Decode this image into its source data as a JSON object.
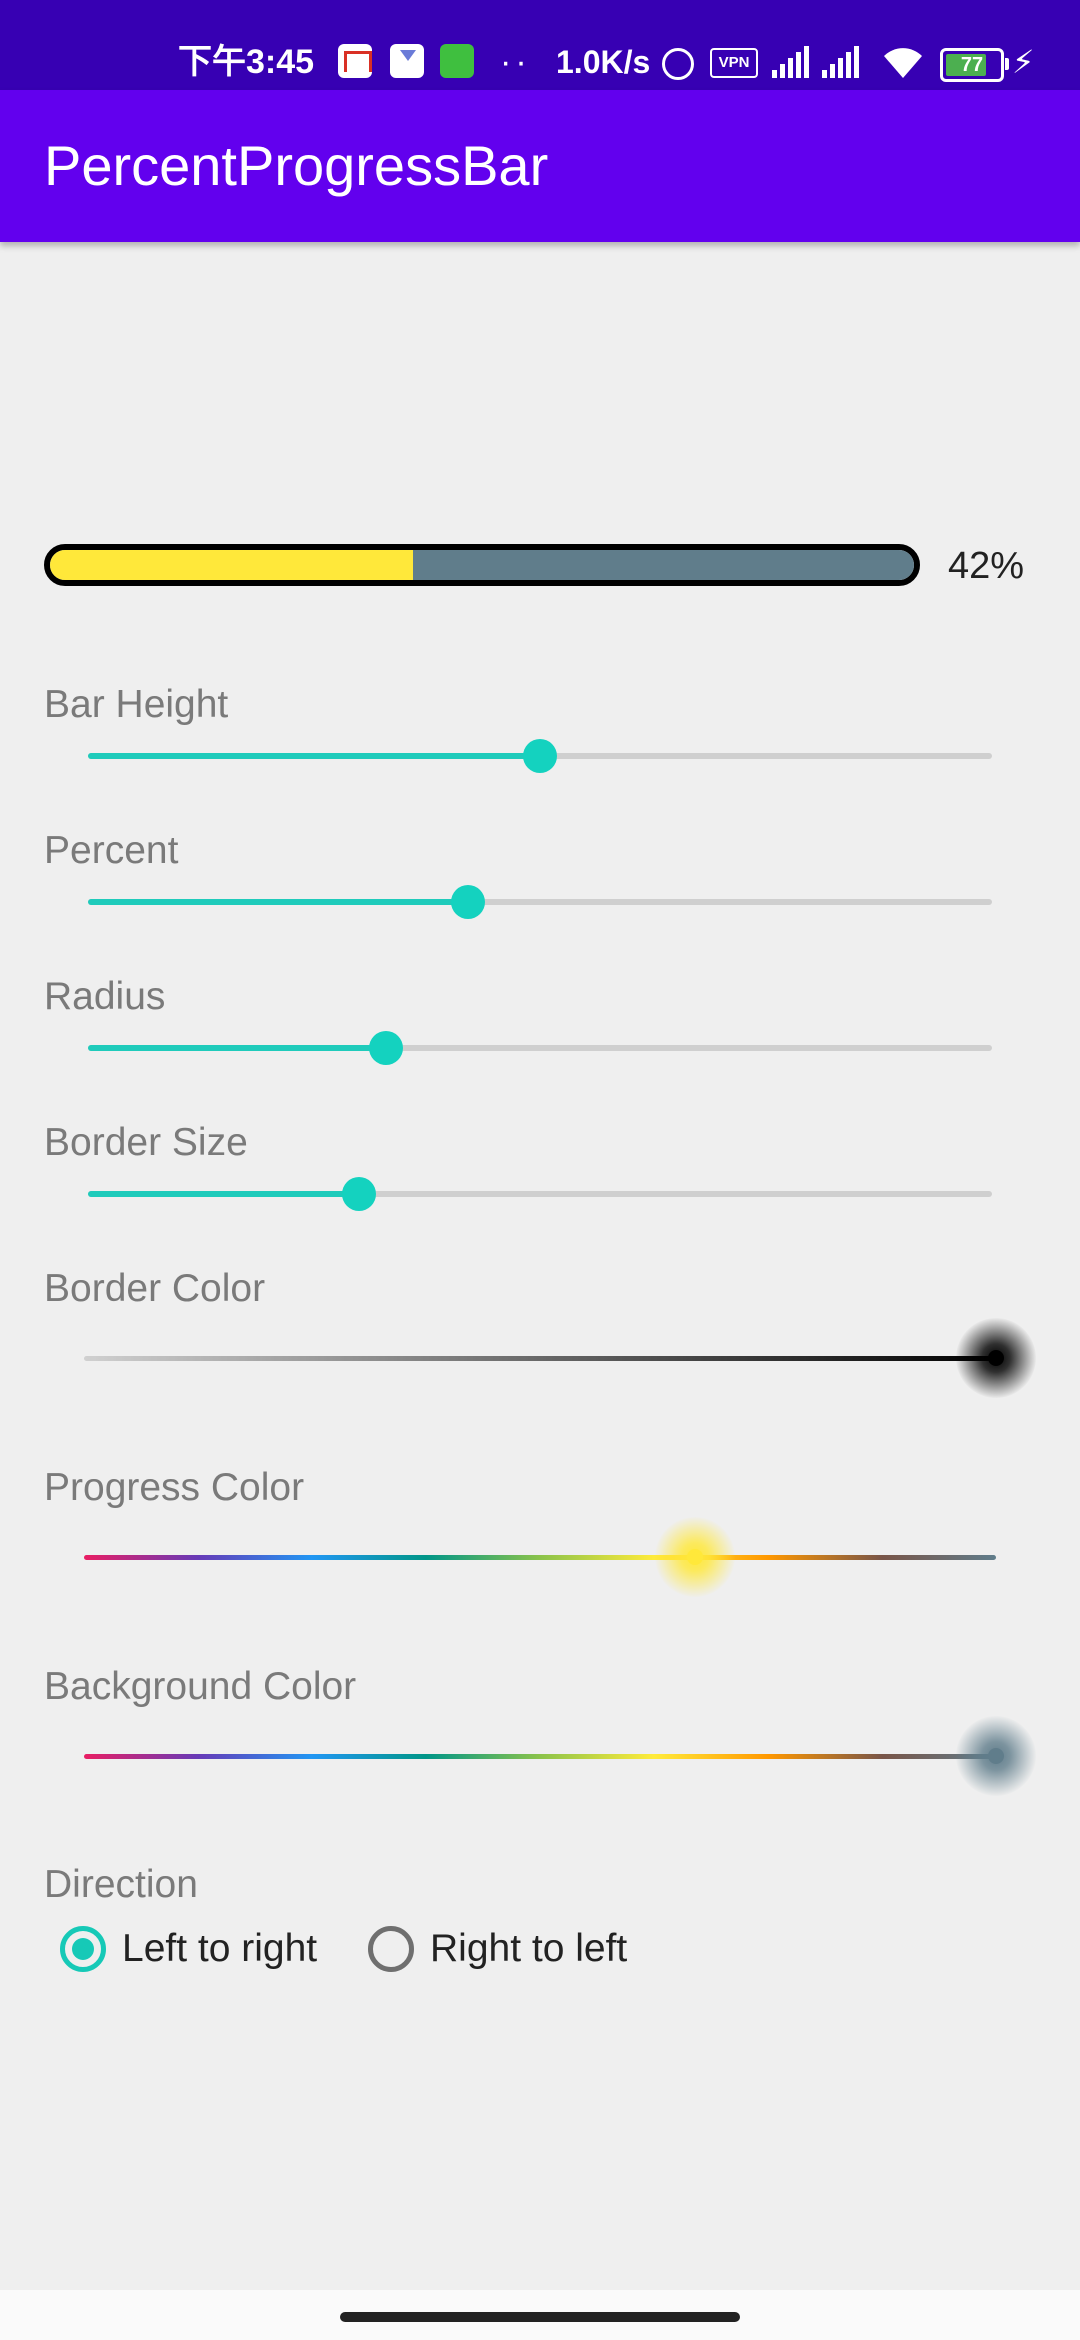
{
  "status_bar": {
    "time": "下午3:45",
    "dots": "··",
    "network_speed": "1.0K/s",
    "vpn": "VPN",
    "battery": "77",
    "icons": [
      "gmail-icon",
      "hourglass-icon",
      "green-app-icon",
      "alarm-icon",
      "vpn-icon",
      "signal-icon",
      "signal-hd-icon",
      "wifi-icon",
      "battery-icon",
      "charging-icon"
    ]
  },
  "app_bar": {
    "title": "PercentProgressBar"
  },
  "progress_bar": {
    "percent_text": "42%",
    "percent": 42,
    "progress_color": "#ffe83a",
    "background_color": "#607d8b",
    "border_color": "#000000"
  },
  "controls": {
    "bar_height": {
      "label": "Bar Height",
      "value": 0.5
    },
    "percent": {
      "label": "Percent",
      "value": 0.42
    },
    "radius": {
      "label": "Radius",
      "value": 0.33
    },
    "border_size": {
      "label": "Border Size",
      "value": 0.3
    },
    "border_color": {
      "label": "Border Color",
      "value": 1.0,
      "color": "#000000"
    },
    "progress_color": {
      "label": "Progress Color",
      "value": 0.67,
      "color": "#ffe83a"
    },
    "background_color": {
      "label": "Background Color",
      "value": 1.0,
      "color": "#607d8b"
    }
  },
  "direction": {
    "label": "Direction",
    "options": [
      {
        "label": "Left to right",
        "checked": true
      },
      {
        "label": "Right to left",
        "checked": false
      }
    ]
  },
  "colors": {
    "status_bar": "#3700b3",
    "app_bar": "#6200ee",
    "accent": "#1fcbbb"
  }
}
